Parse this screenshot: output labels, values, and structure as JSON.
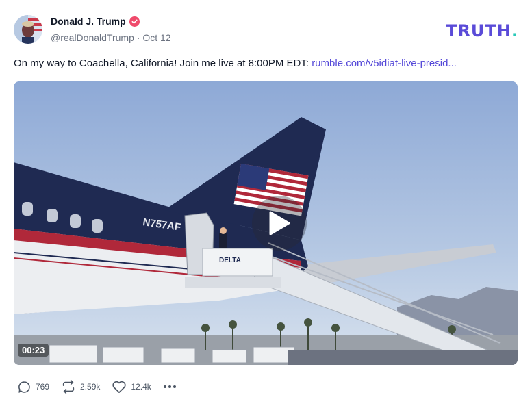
{
  "post": {
    "author_name": "Donald J. Trump",
    "handle": "@realDonaldTrump",
    "date_separator": "·",
    "date": "Oct 12",
    "text": "On my way to Coachella, California! Join me live at 8:00PM EDT: ",
    "link_text": "rumble.com/v5idiat-live-presid..."
  },
  "brand": {
    "word": "TRUTH",
    "dot": "."
  },
  "video": {
    "duration": "00:23",
    "tail_number": "N757AF",
    "stair_brand": "DELTA"
  },
  "actions": {
    "replies": "769",
    "retruths": "2.59k",
    "likes": "12.4k"
  },
  "icons": {
    "verified": "verified-badge-icon",
    "play": "play-icon",
    "reply": "reply-icon",
    "retruth": "retruth-icon",
    "like": "heart-icon",
    "more": "more-dots-icon"
  },
  "colors": {
    "link": "#5448d8",
    "brand": "#5a4bd8",
    "brand_dot": "#29c9b8",
    "verified": "#ef4a6b"
  }
}
